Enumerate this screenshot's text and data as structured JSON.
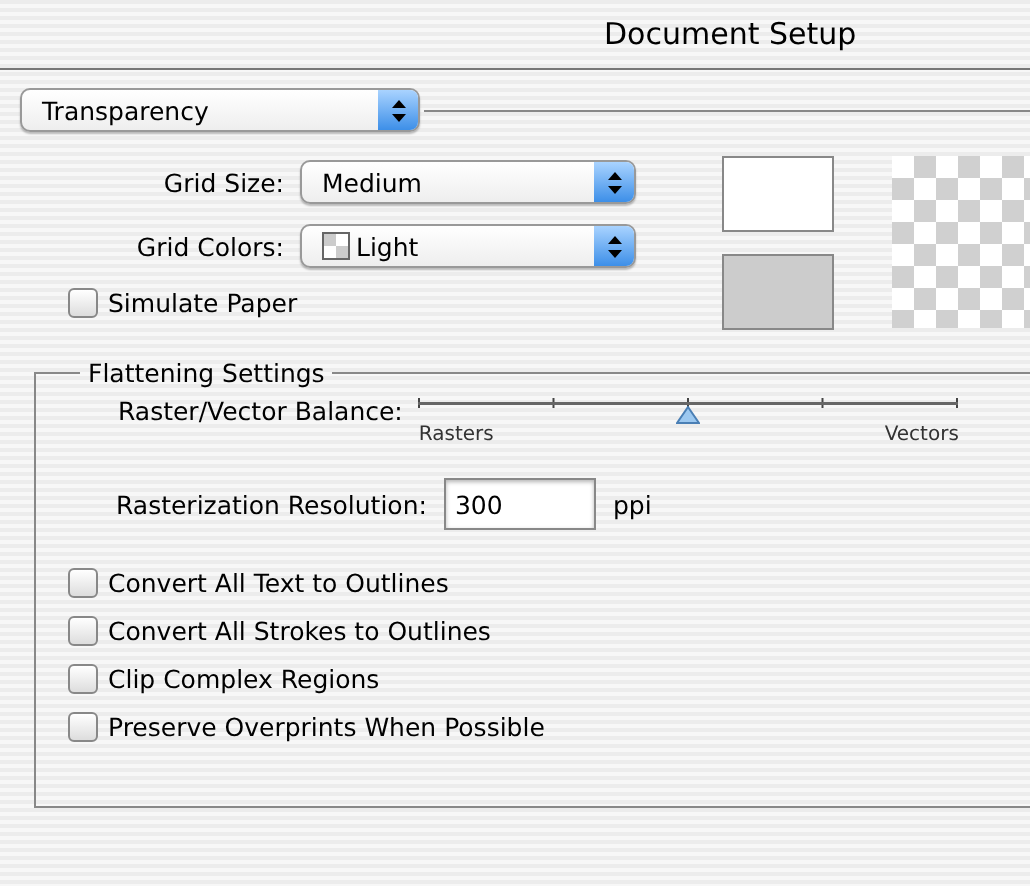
{
  "window": {
    "title": "Document Setup"
  },
  "panel_menu": {
    "value": "Transparency"
  },
  "grid_size": {
    "label": "Grid Size:",
    "value": "Medium"
  },
  "grid_colors": {
    "label": "Grid Colors:",
    "value": "Light"
  },
  "simulate_paper": {
    "label": "Simulate Paper",
    "checked": false
  },
  "flattening": {
    "title": "Flattening Settings",
    "balance": {
      "label": "Raster/Vector Balance:",
      "level": 0.5,
      "min_label": "Rasters",
      "max_label": "Vectors"
    },
    "resolution": {
      "label": "Rasterization Resolution:",
      "value": "300",
      "unit": "ppi"
    },
    "options": [
      {
        "label": "Convert All Text to Outlines",
        "checked": false
      },
      {
        "label": "Convert All Strokes to Outlines",
        "checked": false
      },
      {
        "label": "Clip Complex Regions",
        "checked": false
      },
      {
        "label": "Preserve Overprints When Possible",
        "checked": false
      }
    ]
  }
}
